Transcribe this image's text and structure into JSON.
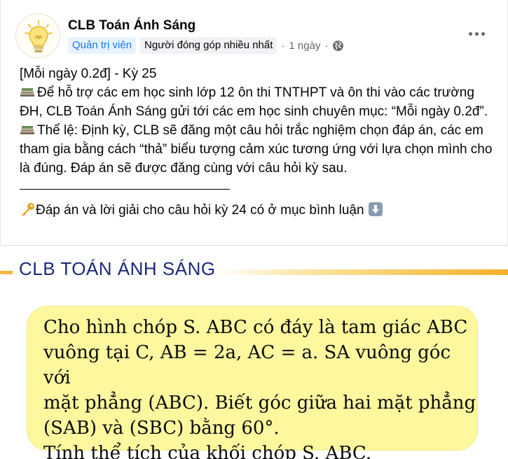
{
  "post": {
    "group_name": "CLB Toán Ánh Sáng",
    "badges": [
      "Quản trị viên",
      "Người đóng góp nhiều nhất"
    ],
    "time": "1 ngày",
    "privacy_icon": "globe-icon",
    "more_icon": "more-options-icon",
    "text": {
      "title": "[Mỗi ngày 0.2đ] - Kỳ 25",
      "para1": "Để hỗ trợ các em học sinh lớp 12 ôn thi TNTHPT và ôn thi vào các trường ĐH, CLB Toán Ánh Sáng gửi tới các em học sinh chuyên mục: “Mỗi ngày 0.2đ”.",
      "para2": "Thể lệ: Định kỳ, CLB sẽ đăng một câu hỏi trắc nghiệm chọn đáp án, các em tham gia bằng cách “thả” biểu tượng cảm xúc tương ứng với lựa chọn mình cho là đúng. Đáp án sẽ được đăng cùng với câu hỏi kỳ sau.",
      "answer_note": "Đáp án và lời giải cho câu hỏi kỳ 24 có ở mục bình luận",
      "icons": [
        "books-icon",
        "key-icon",
        "down-arrow-icon"
      ]
    },
    "image": {
      "header": "CLB TOÁN ÁNH SÁNG",
      "problem": "Cho hình chóp S. ABC có đáy là tam giác ABC\nvuông tại C, AB = 2a, AC = a. SA vuông góc với\nmặt phẳng (ABC).  Biết góc giữa hai mặt phẳng\n(SAB) và (SBC) bằng 60°.\nTính thể tích của khối chóp S. ABC."
    }
  },
  "colors": {
    "admin_badge_bg": "#e7f3ff",
    "admin_badge_text": "#1877f2",
    "problem_box_bg": "#fdf79e",
    "image_title": "#1b2a7a",
    "accent_stripe": "#f4b02a"
  }
}
